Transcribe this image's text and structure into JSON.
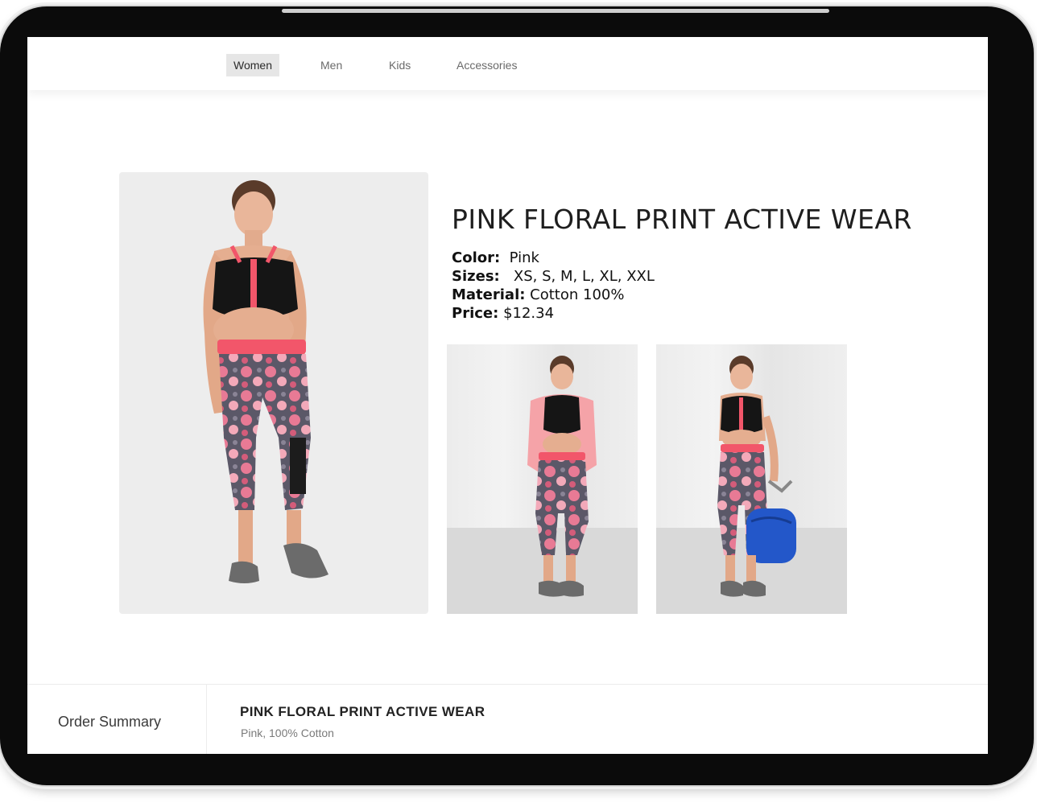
{
  "nav": {
    "items": [
      {
        "label": "Women",
        "active": true
      },
      {
        "label": "Men",
        "active": false
      },
      {
        "label": "Kids",
        "active": false
      },
      {
        "label": "Accessories",
        "active": false
      }
    ]
  },
  "product": {
    "title": "PINK FLORAL PRINT ACTIVE WEAR",
    "specs": [
      {
        "label": "Color:",
        "value": "Pink"
      },
      {
        "label": "Sizes:",
        "value": "XS, S, M, L, XL, XXL"
      },
      {
        "label": "Material:",
        "value": "Cotton 100%"
      },
      {
        "label": "Price:",
        "value": "$12.34"
      }
    ]
  },
  "order_summary": {
    "label": "Order Summary",
    "item_name": "PINK FLORAL PRINT ACTIVE WEAR",
    "item_desc": "Pink, 100% Cotton"
  },
  "colors": {
    "accent_pink": "#f2566a",
    "legging_pattern": "#e87a95",
    "bag_blue": "#2357c9"
  }
}
